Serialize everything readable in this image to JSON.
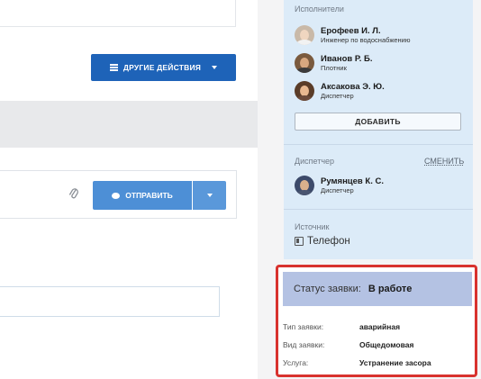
{
  "left": {
    "actions_button_label": "ДРУГИЕ ДЕЙСТВИЯ",
    "send_button_label": "ОТПРАВИТЬ"
  },
  "panel": {
    "executors_label": "Исполнители",
    "executors": [
      {
        "name": "Ерофеев И. Л.",
        "role": "Инженер по водоснабжению"
      },
      {
        "name": "Иванов Р. Б.",
        "role": "Плотник"
      },
      {
        "name": "Аксакова Э. Ю.",
        "role": "Диспетчер"
      }
    ],
    "add_button_label": "ДОБАВИТЬ",
    "dispatcher_label": "Диспетчер",
    "change_link_label": "СМЕНИТЬ",
    "dispatcher": {
      "name": "Румянцев К. С.",
      "role": "Диспетчер"
    },
    "source_label": "Источник",
    "source_value": "Телефон"
  },
  "status": {
    "label": "Статус заявки:",
    "value": "В работе",
    "highlight_color": "#d8322e",
    "details": [
      {
        "key": "Тип заявки:",
        "value": "аварийная"
      },
      {
        "key": "Вид заявки:",
        "value": "Общедомовая"
      },
      {
        "key": "Услуга:",
        "value": "Устранение засора"
      }
    ]
  },
  "colors": {
    "primary_button": "#1e63b8",
    "send_button": "#4d8fd6",
    "panel_background": "#dcebf8",
    "status_bar": "#b4c2e3"
  }
}
